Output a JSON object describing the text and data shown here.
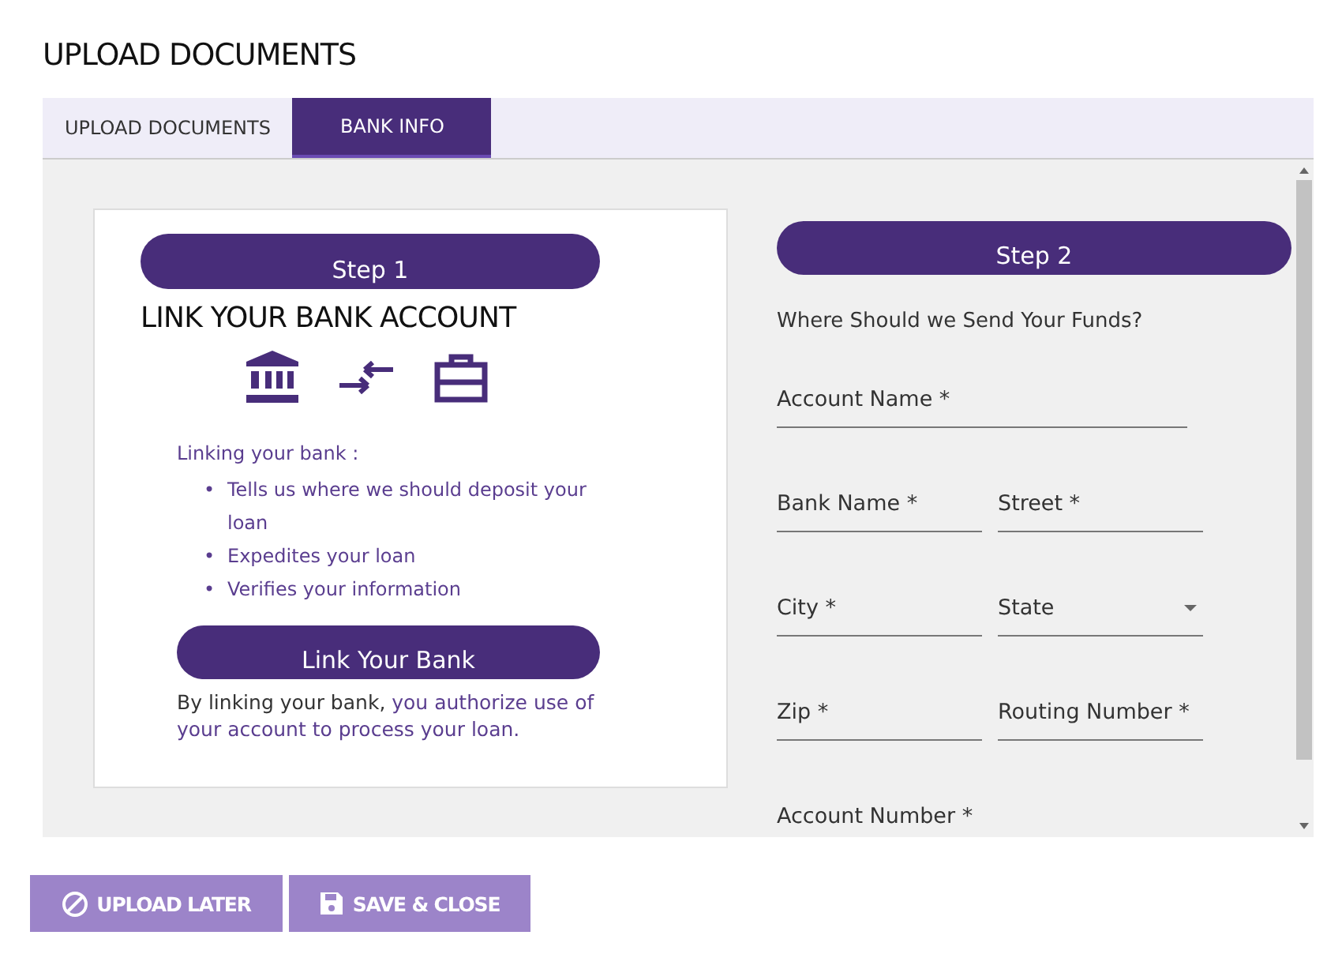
{
  "page_title": "UPLOAD DOCUMENTS",
  "tabs": [
    {
      "label": "UPLOAD DOCUMENTS",
      "selected": false
    },
    {
      "label": "BANK INFO",
      "selected": true
    }
  ],
  "step1": {
    "badge": "Step 1",
    "heading": "LINK YOUR BANK ACCOUNT",
    "intro": "Linking your bank :",
    "bullet": "•",
    "benefits": [
      "Tells us where we should deposit your loan",
      "Expedites your loan",
      "Verifies your information"
    ],
    "button": "Link Your Bank",
    "note_lead": "By linking your bank,",
    "note_link": "you authorize use of your account to process your loan."
  },
  "step2": {
    "badge": "Step 2",
    "question": "Where Should we Send Your Funds?",
    "rows": [
      [
        {
          "kind": "text",
          "placeholder": "Account Name *"
        }
      ],
      [
        {
          "kind": "text",
          "placeholder": "Bank Name *"
        },
        {
          "kind": "text",
          "placeholder": "Street *"
        }
      ],
      [
        {
          "kind": "text",
          "placeholder": "City *"
        },
        {
          "kind": "select",
          "placeholder": "State"
        }
      ],
      [
        {
          "kind": "text",
          "placeholder": "Zip *"
        },
        {
          "kind": "text",
          "placeholder": "Routing Number *"
        }
      ],
      [
        {
          "kind": "text",
          "placeholder": "Account Number *"
        }
      ]
    ]
  },
  "buttons": [
    {
      "kind": "later",
      "label": "UPLOAD LATER"
    },
    {
      "kind": "save",
      "label": "SAVE & CLOSE"
    }
  ]
}
